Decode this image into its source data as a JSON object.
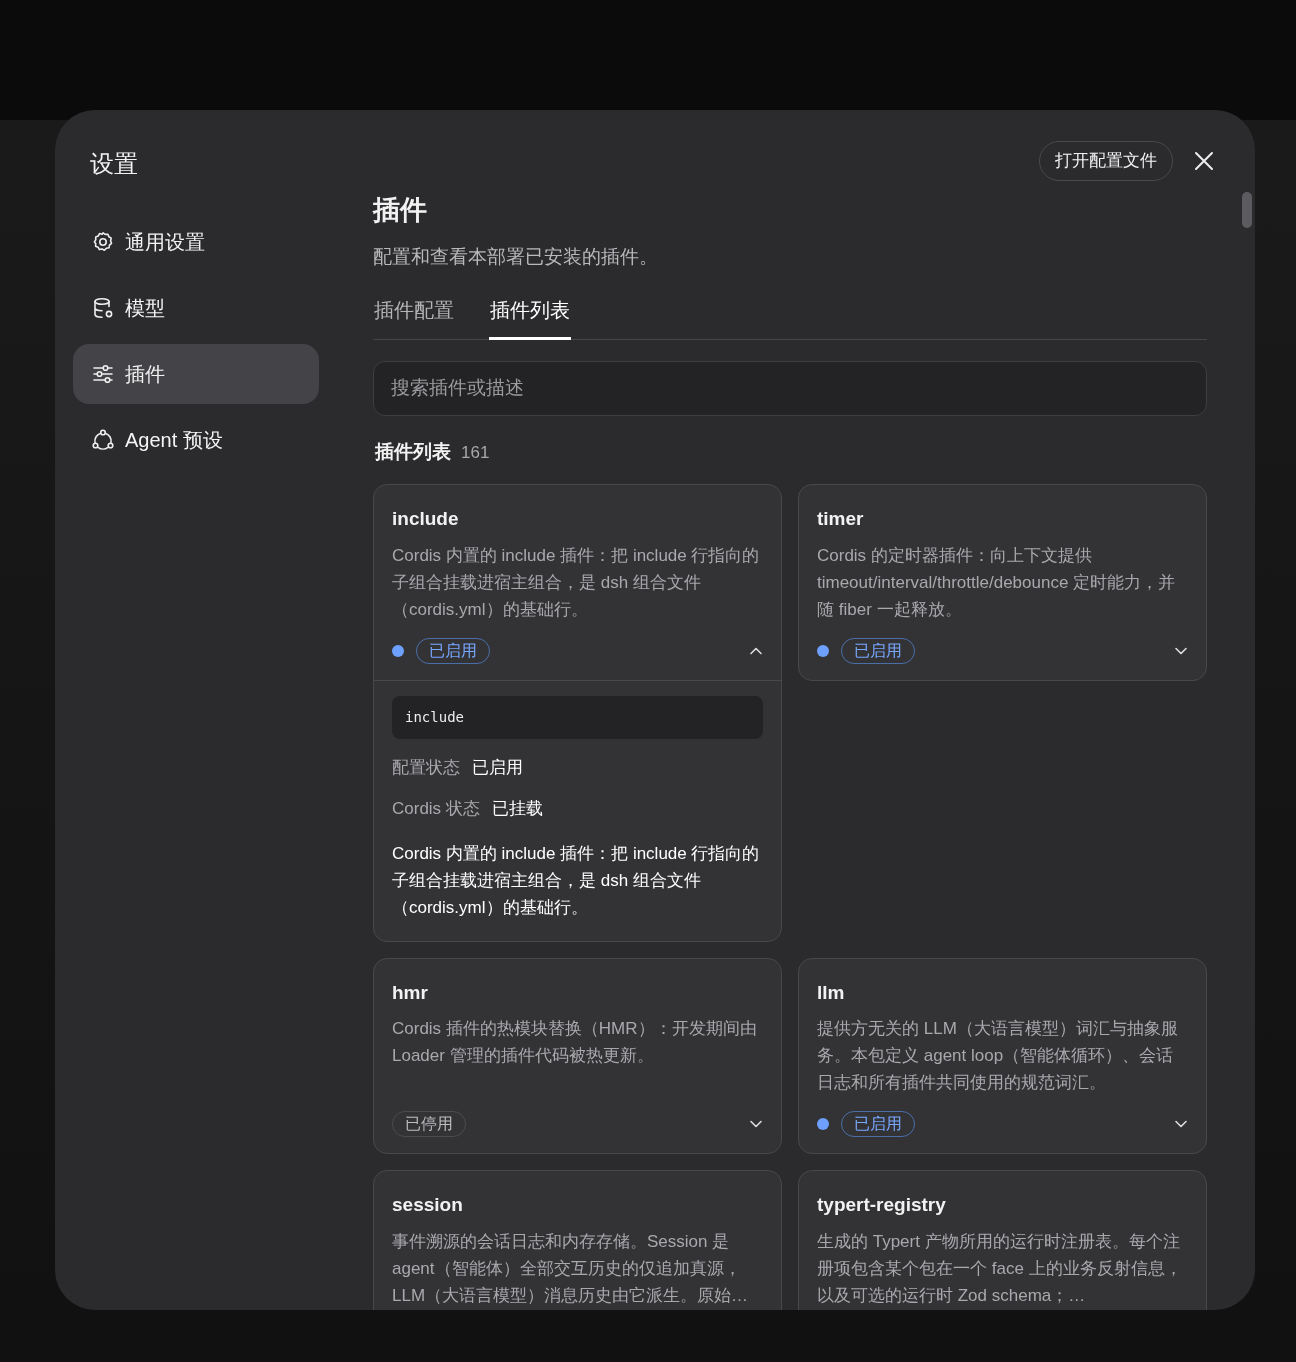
{
  "modal": {
    "title": "设置",
    "open_config_button": "打开配置文件"
  },
  "sidebar": {
    "items": [
      {
        "label": "通用设置",
        "selected": false
      },
      {
        "label": "模型",
        "selected": false
      },
      {
        "label": "插件",
        "selected": true
      },
      {
        "label": "Agent 预设",
        "selected": false
      }
    ]
  },
  "page": {
    "title": "插件",
    "subtitle": "配置和查看本部署已安装的插件。",
    "tabs": [
      {
        "label": "插件配置",
        "selected": false
      },
      {
        "label": "插件列表",
        "selected": true
      }
    ],
    "search": {
      "placeholder": "搜索插件或描述"
    },
    "list_title": "插件列表",
    "count": "161"
  },
  "plugins": [
    {
      "name": "include",
      "description": "Cordis 内置的 include 插件：把 include 行指向的子组合挂载进宿主组合，是 dsh 组合文件（cordis.yml）的基础行。",
      "enabled": true,
      "status": "已启用",
      "expanded": true,
      "details": {
        "id": "include",
        "rows": [
          {
            "label": "配置状态",
            "value": "已启用"
          },
          {
            "label": "Cordis 状态",
            "value": "已挂载"
          }
        ],
        "description": "Cordis 内置的 include 插件：把 include 行指向的子组合挂载进宿主组合，是 dsh 组合文件（cordis.yml）的基础行。"
      }
    },
    {
      "name": "timer",
      "description": "Cordis 的定时器插件：向上下文提供 timeout/interval/throttle/debounce 定时能力，并随 fiber 一起释放。",
      "enabled": true,
      "status": "已启用",
      "expanded": false
    },
    {
      "name": "hmr",
      "description": "Cordis 插件的热模块替换（HMR）：开发期间由 Loader 管理的插件代码被热更新。",
      "enabled": false,
      "status": "已停用",
      "expanded": false
    },
    {
      "name": "llm",
      "description": "提供方无关的 LLM（大语言模型）词汇与抽象服务。本包定义 agent loop（智能体循环）、会话日志和所有插件共同使用的规范词汇。",
      "enabled": true,
      "status": "已启用",
      "expanded": false
    },
    {
      "name": "session",
      "description": "事件溯源的会话日志和内存存储。Session 是 agent（智能体）全部交互历史的仅追加真源，LLM（大语言模型）消息历史由它派生。原始…"
    },
    {
      "name": "typert-registry",
      "description": "生成的 Typert 产物所用的运行时注册表。每个注册项包含某个包在一个 face 上的业务反射信息，以及可选的运行时 Zod schema；…"
    }
  ]
}
